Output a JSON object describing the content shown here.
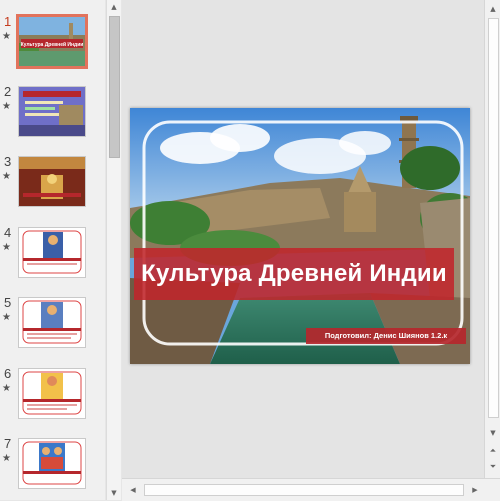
{
  "thumbnails": [
    {
      "number": "1",
      "caption": "Культура Древней Индии",
      "selected": true
    },
    {
      "number": "2",
      "selected": false
    },
    {
      "number": "3",
      "selected": false
    },
    {
      "number": "4",
      "selected": false
    },
    {
      "number": "5",
      "selected": false
    },
    {
      "number": "6",
      "selected": false
    },
    {
      "number": "7",
      "selected": false
    }
  ],
  "slide": {
    "title": "Культура Древней Индии",
    "subtitle": "Подготовил: Денис Шиянов 1.2.к"
  },
  "colors": {
    "accent_red": "#c0262b",
    "selection": "#e2735c"
  },
  "icons": {
    "animation": "star-icon",
    "scroll_up": "triangle-up-icon",
    "scroll_down": "triangle-down-icon",
    "prev_slide": "double-chevron-up-icon",
    "next_slide": "double-chevron-down-icon"
  }
}
